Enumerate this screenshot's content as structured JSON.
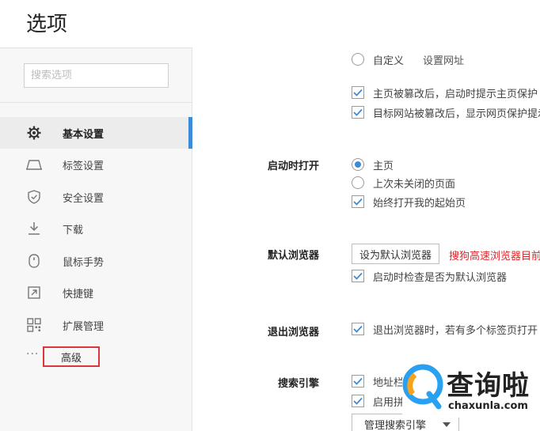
{
  "header": {
    "title": "选项"
  },
  "sidebar": {
    "search_placeholder": "搜索选项",
    "items": [
      {
        "label": "基本设置",
        "icon": "gear-icon",
        "active": true
      },
      {
        "label": "标签设置",
        "icon": "tab-icon"
      },
      {
        "label": "安全设置",
        "icon": "shield-check-icon"
      },
      {
        "label": "下载",
        "icon": "download-icon"
      },
      {
        "label": "鼠标手势",
        "icon": "mouse-icon"
      },
      {
        "label": "快捷键",
        "icon": "shortcut-icon"
      },
      {
        "label": "扩展管理",
        "icon": "extensions-icon"
      }
    ],
    "advanced": {
      "dots": "···",
      "label": "高级"
    }
  },
  "main": {
    "homepage": {
      "custom_label": "自定义",
      "set_url_link": "设置网址",
      "opt_tampered": "主页被篡改后，启动时提示主页保护",
      "opt_target_tampered": "目标网站被篡改后，显示网页保护提示"
    },
    "startup": {
      "label": "启动时打开",
      "opt_home": "主页",
      "opt_last_session": "上次未关闭的页面",
      "opt_start_page": "始终打开我的起始页"
    },
    "default_browser": {
      "label": "默认浏览器",
      "button": "设为默认浏览器",
      "status": "搜狗高速浏览器目前",
      "opt_check": "启动时检查是否为默认浏览器"
    },
    "exit_browser": {
      "label": "退出浏览器",
      "opt_warn": "退出浏览器时，若有多个标签页打开"
    },
    "search_engine": {
      "label": "搜索引擎",
      "opt_address": "地址栏",
      "opt_enable": "启用拼",
      "manage_button": "管理搜索引擎"
    }
  },
  "watermark": {
    "text": "查询啦",
    "url": "chaxunla.com"
  },
  "colors": {
    "accent": "#3b8bd6",
    "highlight_red": "#d9363e",
    "status_red": "#e0272b"
  }
}
